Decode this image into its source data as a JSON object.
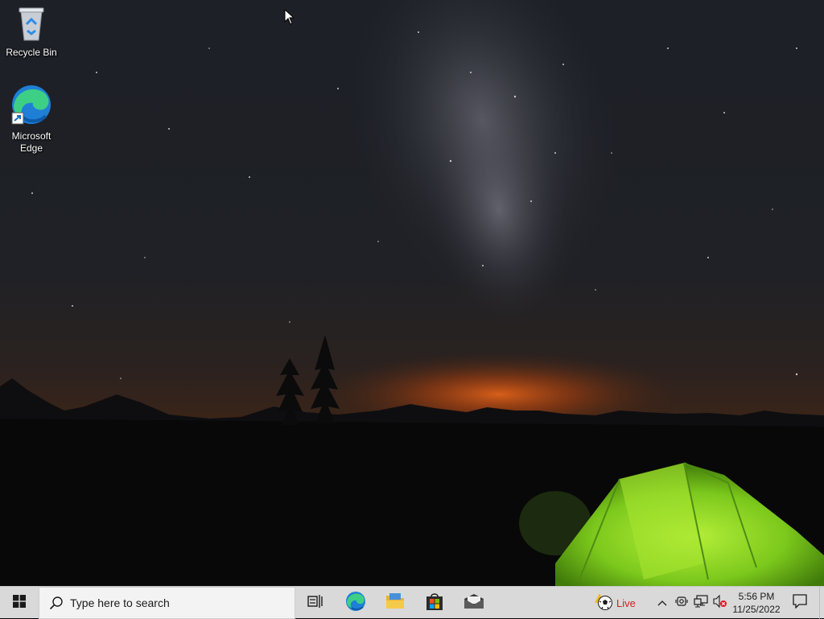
{
  "desktop": {
    "icons": [
      {
        "label": "Recycle Bin",
        "icon": "recycle-bin-icon"
      },
      {
        "label": "Microsoft\nEdge",
        "icon": "edge-icon"
      }
    ]
  },
  "taskbar": {
    "search_placeholder": "Type here to search",
    "pinned": [
      {
        "name": "Task View",
        "icon": "task-view-icon"
      },
      {
        "name": "Microsoft Edge",
        "icon": "edge-icon"
      },
      {
        "name": "File Explorer",
        "icon": "folder-icon"
      },
      {
        "name": "Microsoft Store",
        "icon": "store-icon"
      },
      {
        "name": "Mail",
        "icon": "mail-icon"
      }
    ],
    "weather_live": "Live",
    "clock": {
      "time": "5:56 PM",
      "date": "11/25/2022"
    },
    "colors": {
      "taskbar": "#d9d9d9",
      "accent_windows": "#1a1a1a",
      "live_text": "#c8261b"
    }
  }
}
